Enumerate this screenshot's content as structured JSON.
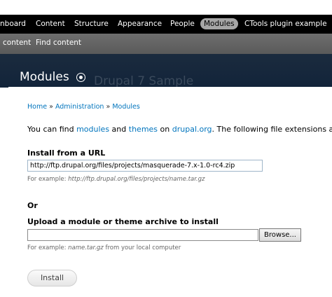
{
  "toolbar": {
    "items": [
      "nboard",
      "Content",
      "Structure",
      "Appearance",
      "People",
      "Modules",
      "CTools plugin example"
    ]
  },
  "shortcuts": {
    "items": [
      "content",
      "Find content"
    ]
  },
  "header": {
    "title": "Modules",
    "site_name": "Drupal 7 Sample"
  },
  "breadcrumb": {
    "home": "Home",
    "sep": "»",
    "administration": "Administration",
    "modules": "Modules"
  },
  "intro": {
    "part1": "You can find ",
    "modules_link": "modules",
    "part2": " and ",
    "themes_link": "themes",
    "part3": " on ",
    "drupal_link": "drupal.org",
    "part4": ". The following file extensions ar"
  },
  "install_url": {
    "label": "Install from a URL",
    "value": "http://ftp.drupal.org/files/projects/masquerade-7.x-1.0-rc4.zip",
    "desc_prefix": "For example: ",
    "desc_example": "http://ftp.drupal.org/files/projects/name.tar.gz"
  },
  "or_text": "Or",
  "upload": {
    "label": "Upload a module or theme archive to install",
    "browse": "Browse...",
    "desc_prefix": "For example: ",
    "desc_example": "name.tar.gz",
    "desc_suffix": " from your local computer"
  },
  "install_button": "Install"
}
